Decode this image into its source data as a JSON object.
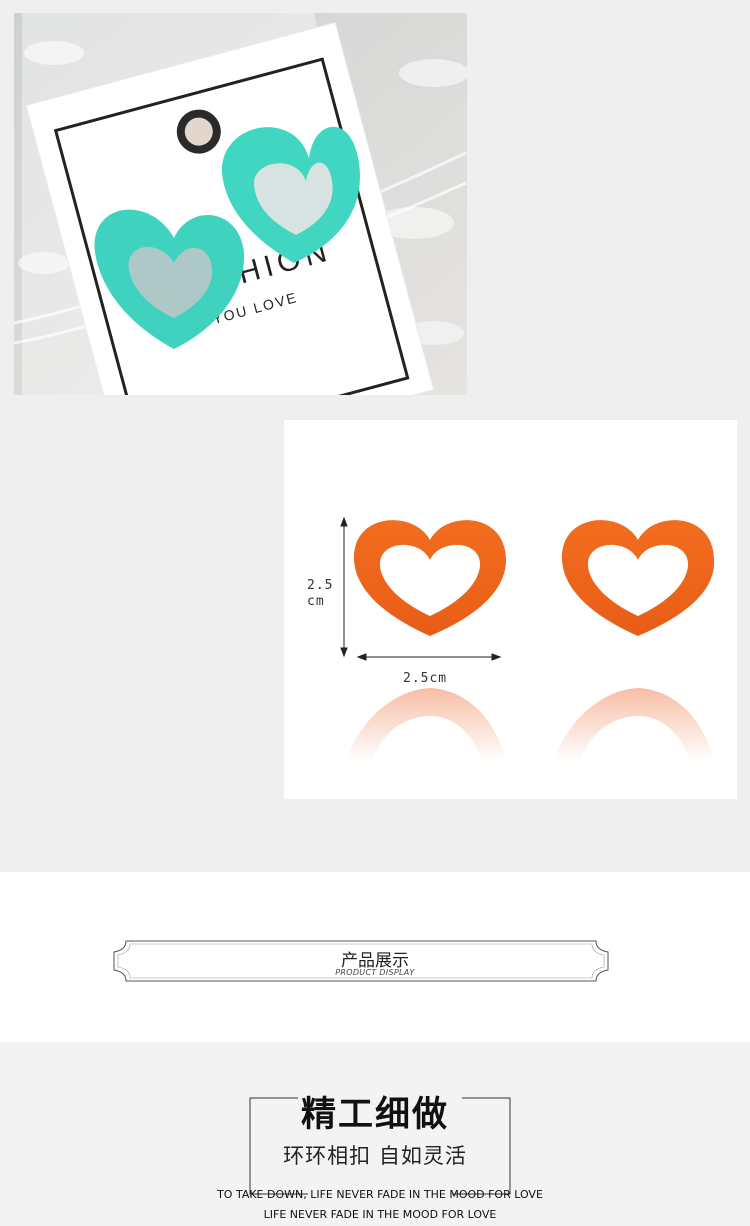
{
  "product_photo": {
    "card_text_main": "FASHION",
    "card_text_sub": "YOU LOVE",
    "earring_color": "#40d4c0"
  },
  "size_chart": {
    "height_value": "2.5",
    "height_unit": "cm",
    "width_label": "2.5cm",
    "earring_color": "#f06a1c"
  },
  "section_banner": {
    "title": "产品展示",
    "subtitle": "PRODUCT DISPLAY"
  },
  "footer": {
    "title": "精工细做",
    "subtitle": "环环相扣 自如灵活",
    "line1": "TO TAKE DOWN,  LIFE NEVER FADE IN THE MOOD FOR LOVE",
    "line2": "LIFE NEVER FADE IN THE MOOD FOR LOVE"
  }
}
